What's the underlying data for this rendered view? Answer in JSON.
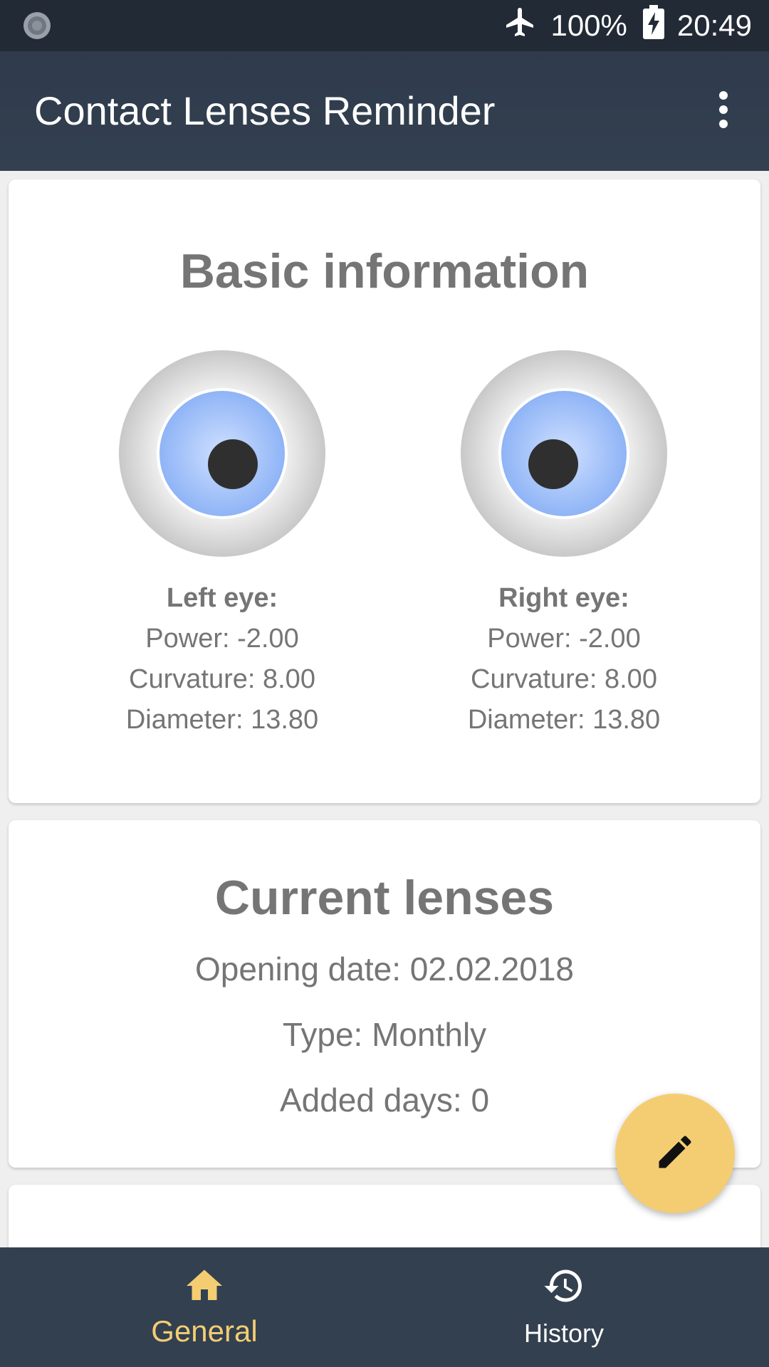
{
  "status_bar": {
    "battery_percent": "100%",
    "time": "20:49",
    "icons": [
      "notification-dot-icon",
      "airplane-mode-icon",
      "battery-charging-icon"
    ]
  },
  "app_bar": {
    "title": "Contact Lenses Reminder",
    "menu_icon": "more-vert-icon"
  },
  "basic_info": {
    "title": "Basic information",
    "left_eye": {
      "label": "Left eye:",
      "power": "Power: -2.00",
      "curvature": "Curvature: 8.00",
      "diameter": "Diameter: 13.80"
    },
    "right_eye": {
      "label": "Right eye:",
      "power": "Power: -2.00",
      "curvature": "Curvature: 8.00",
      "diameter": "Diameter: 13.80"
    }
  },
  "current_lenses": {
    "title": "Current lenses",
    "opening_date": "Opening date: 02.02.2018",
    "type": "Type: Monthly",
    "added_days": "Added days: 0"
  },
  "fab": {
    "icon": "edit-pencil-icon"
  },
  "bottom_nav": {
    "items": [
      {
        "label": "General",
        "icon": "home-icon",
        "active": true
      },
      {
        "label": "History",
        "icon": "history-icon",
        "active": false
      }
    ]
  },
  "colors": {
    "status_bar": "#222a36",
    "app_bar": "#334050",
    "accent": "#f4cd73",
    "text_gray": "#757575",
    "iris": "#a4c4fb"
  }
}
